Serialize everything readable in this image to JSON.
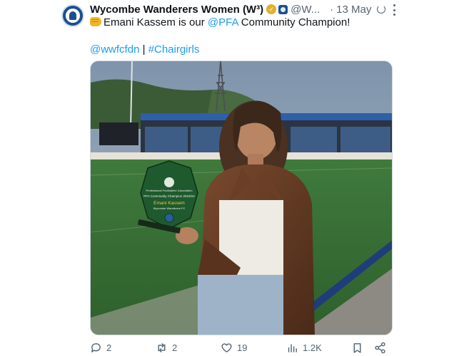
{
  "tweet": {
    "display_name": "Wycombe Wanderers Women (W³)",
    "handle": "@W...",
    "date": "13 May",
    "text_prefix": "Emani Kassem is our ",
    "mention": "@PFA",
    "text_suffix": " Community Champion!",
    "tag_account": "@wwfcfdn",
    "tag_separator": " | ",
    "hashtag": "#Chairgirls"
  },
  "media": {
    "award": {
      "line1": "Professional Footballers' Association",
      "line2": "PFA Community Champion 2023/24",
      "name": "Emani Kassem",
      "club": "Wycombe Wanderers FC"
    }
  },
  "actions": {
    "replies": "2",
    "reposts": "2",
    "likes": "19",
    "views": "1.2K"
  },
  "icons": [
    "avatar-crest",
    "verified-badge-icon",
    "affiliate-badge-icon",
    "edit-icon",
    "more-icon",
    "fist-emoji-icon",
    "reply-icon",
    "repost-icon",
    "like-icon",
    "views-icon",
    "bookmark-icon",
    "share-icon"
  ],
  "colors": {
    "link": "#1d9bf0",
    "text": "#0f1419",
    "muted": "#536471",
    "verified": "#e3b02a"
  }
}
